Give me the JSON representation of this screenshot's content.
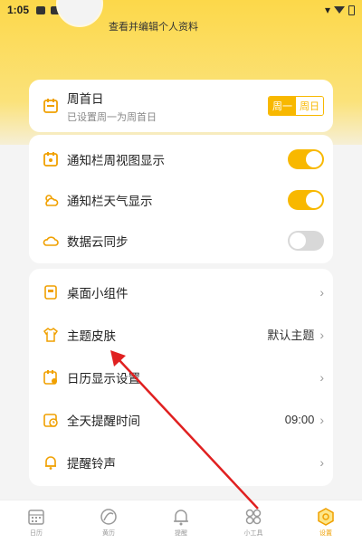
{
  "status_bar": {
    "time": "1:05"
  },
  "profile": {
    "hint": "查看并编辑个人资料"
  },
  "week_start": {
    "title": "周首日",
    "subtitle": "已设置周一为周首日",
    "option_a": "周一",
    "option_b": "周日",
    "selected": "周一"
  },
  "toggles": [
    {
      "label": "通知栏周视图显示",
      "on": true,
      "icon": "calendar-icon"
    },
    {
      "label": "通知栏天气显示",
      "on": true,
      "icon": "weather-icon"
    },
    {
      "label": "数据云同步",
      "on": false,
      "icon": "cloud-icon"
    }
  ],
  "settings": [
    {
      "label": "桌面小组件",
      "value": "",
      "icon": "widget-icon"
    },
    {
      "label": "主题皮肤",
      "value": "默认主题",
      "icon": "shirt-icon"
    },
    {
      "label": "日历显示设置",
      "value": "",
      "icon": "calendar-settings-icon"
    },
    {
      "label": "全天提醒时间",
      "value": "09:00",
      "icon": "clock-icon"
    },
    {
      "label": "提醒铃声",
      "value": "",
      "icon": "bell-icon"
    }
  ],
  "bottom_nav": [
    {
      "label": "日历",
      "icon": "calendar-icon",
      "active": false
    },
    {
      "label": "黄历",
      "icon": "almanac-icon",
      "active": false
    },
    {
      "label": "提醒",
      "icon": "bell-icon",
      "active": false
    },
    {
      "label": "小工具",
      "icon": "tools-icon",
      "active": false
    },
    {
      "label": "设置",
      "icon": "settings-icon",
      "active": true
    }
  ],
  "colors": {
    "accent": "#f8b800",
    "arrow": "#e02020",
    "header": "#fcd84a"
  }
}
